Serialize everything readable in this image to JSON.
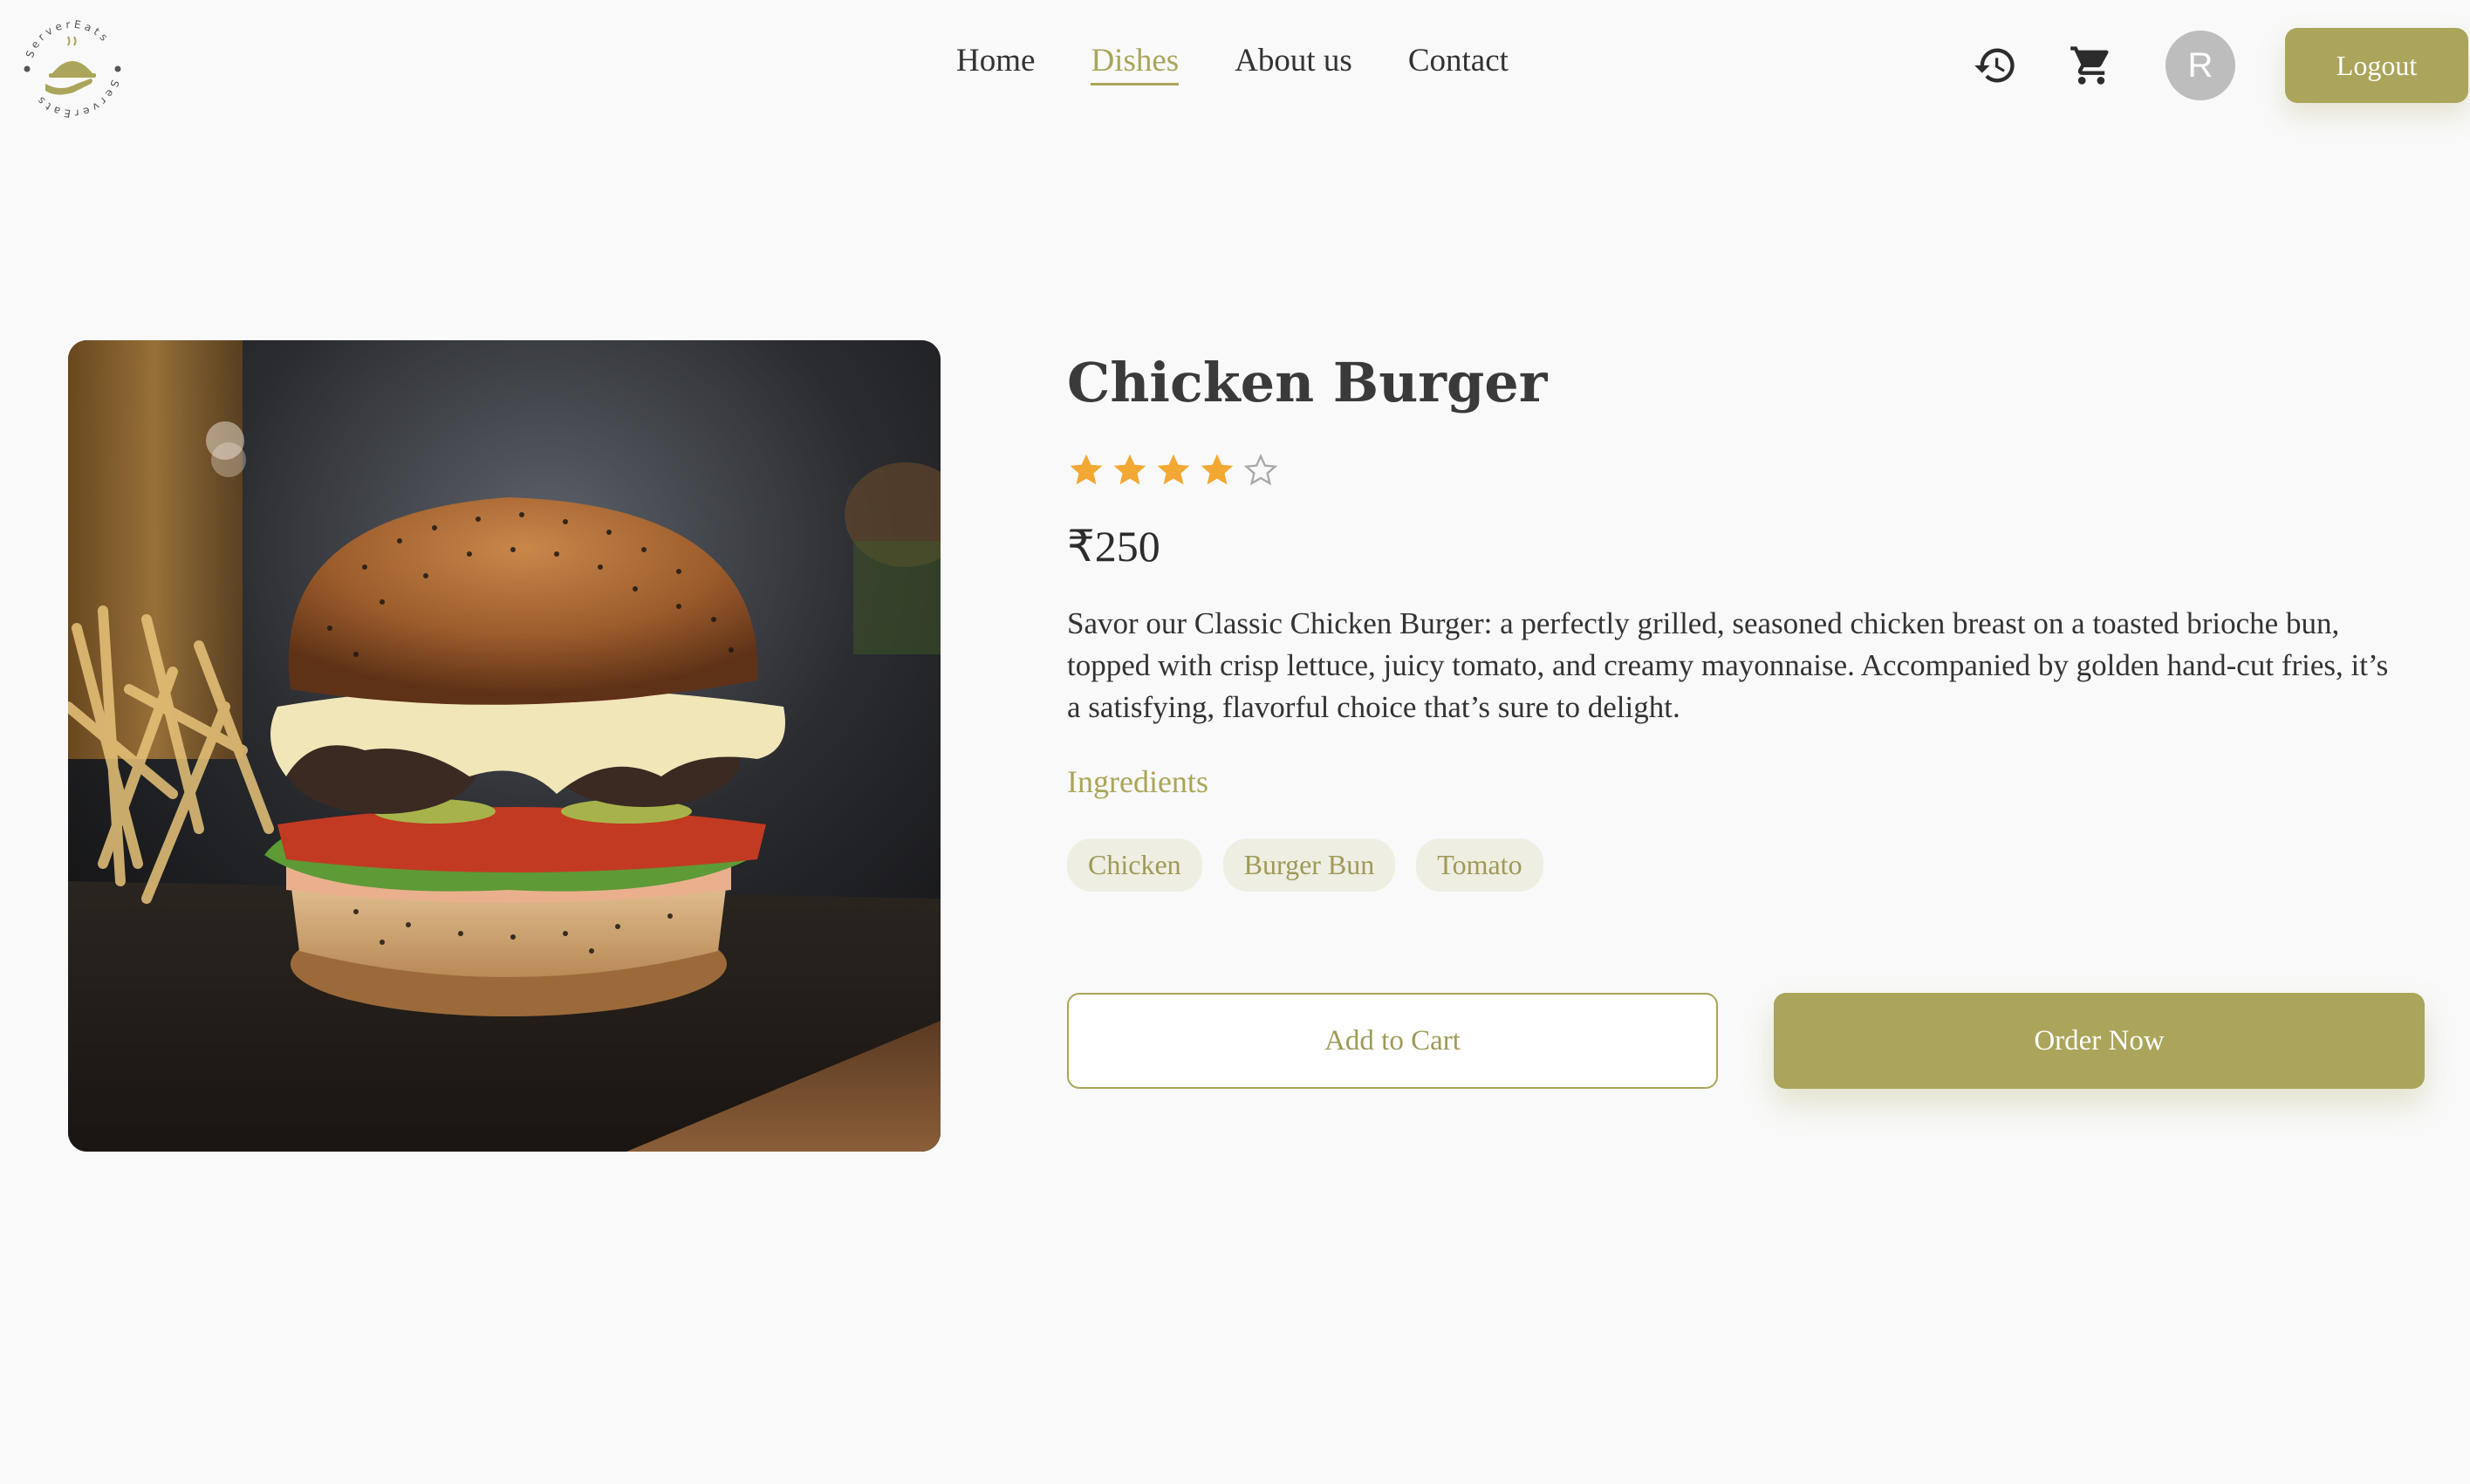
{
  "brand": {
    "logo_icon": "serving-dish-logo",
    "logo_ring_text": "ServerEats",
    "accent_color": "#aaa55a"
  },
  "nav": {
    "links": [
      "Home",
      "Dishes",
      "About us",
      "Contact"
    ],
    "active": "Dishes"
  },
  "header": {
    "history_icon": "history-icon",
    "cart_icon": "cart-icon",
    "avatar_initial": "R",
    "logout_label": "Logout"
  },
  "dish": {
    "image_icon": "burger-photo",
    "title": "Chicken Burger",
    "rating": 4,
    "rating_max": 5,
    "price": "₹250",
    "description": "Savor our Classic Chicken Burger: a perfectly grilled, seasoned chicken breast on a toasted brioche bun, topped with crisp lettuce, juicy tomato, and creamy mayonnaise. Accompanied by golden hand-cut fries, it’s a satisfying, flavorful choice that’s sure to delight.",
    "ingredients_title": "Ingredients",
    "ingredients": [
      "Chicken",
      "Burger Bun",
      "Tomato"
    ]
  },
  "actions": {
    "add_to_cart": "Add to Cart",
    "order_now": "Order Now"
  }
}
